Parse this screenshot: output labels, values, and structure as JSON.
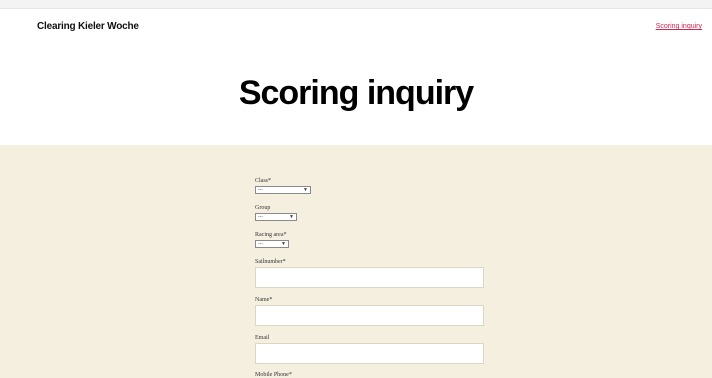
{
  "header": {
    "site_title": "Clearing Kieler Woche",
    "nav_link": "Scoring inquiry"
  },
  "page": {
    "title": "Scoring inquiry"
  },
  "form": {
    "class_label": "Class*",
    "class_value": "---",
    "group_label": "Group",
    "group_value": "---",
    "racing_area_label": "Racing area*",
    "racing_area_value": "---",
    "sailnumber_label": "Sailnumber*",
    "sailnumber_value": "",
    "name_label": "Name*",
    "name_value": "",
    "email_label": "Email",
    "email_value": "",
    "mobile_label": "Mobile Phone*"
  }
}
